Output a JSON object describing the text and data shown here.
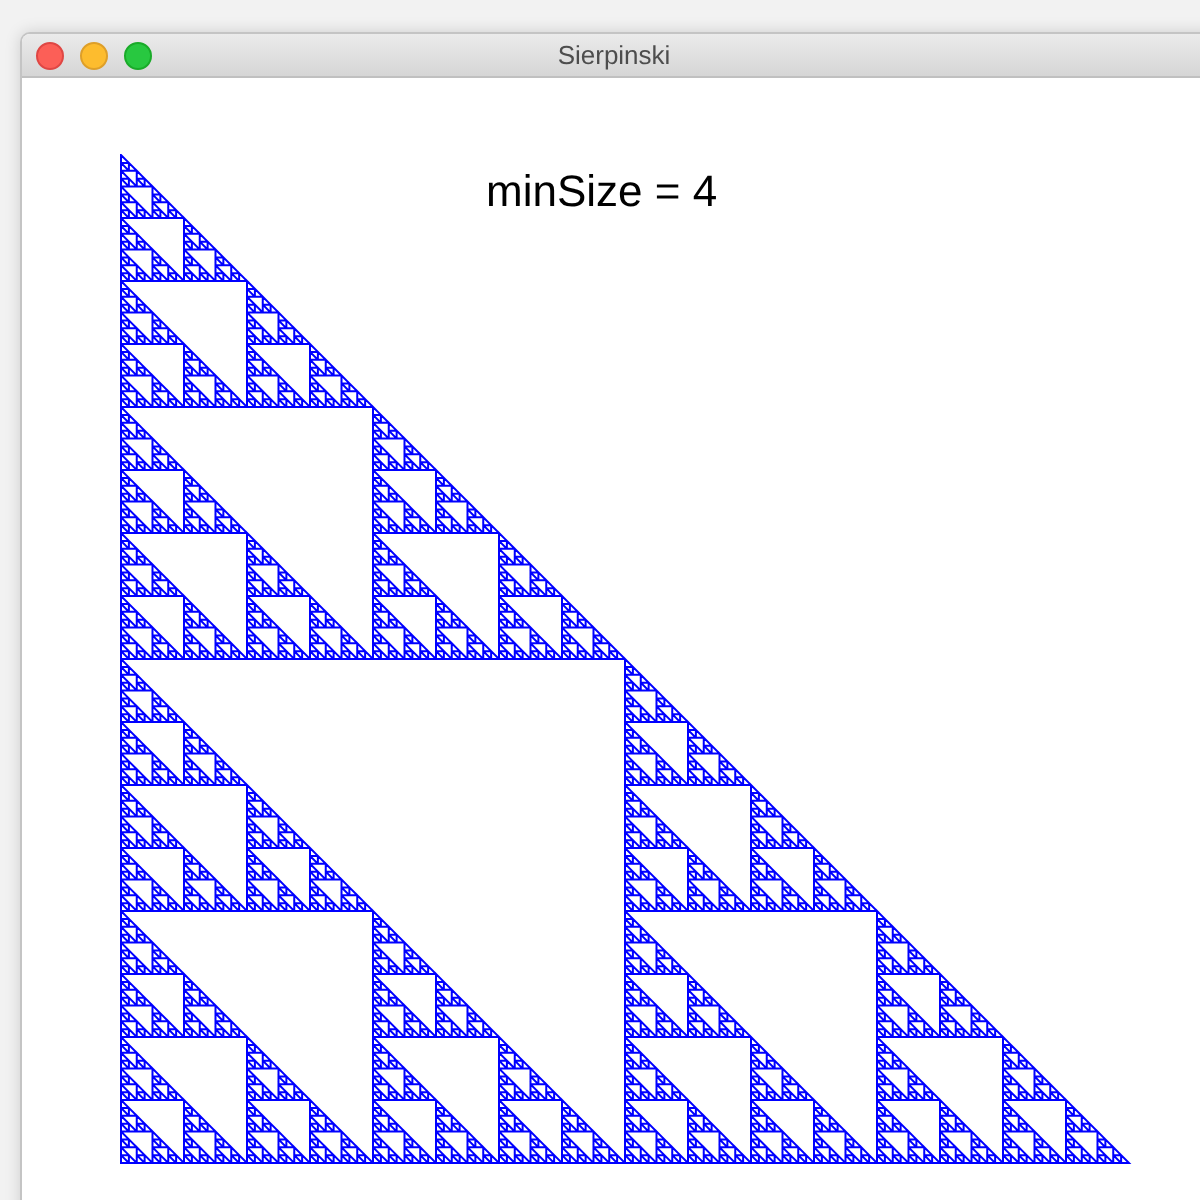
{
  "window": {
    "title": "Sierpinski"
  },
  "canvas": {
    "label": "minSize = 4",
    "kind": "picture"
  }
}
